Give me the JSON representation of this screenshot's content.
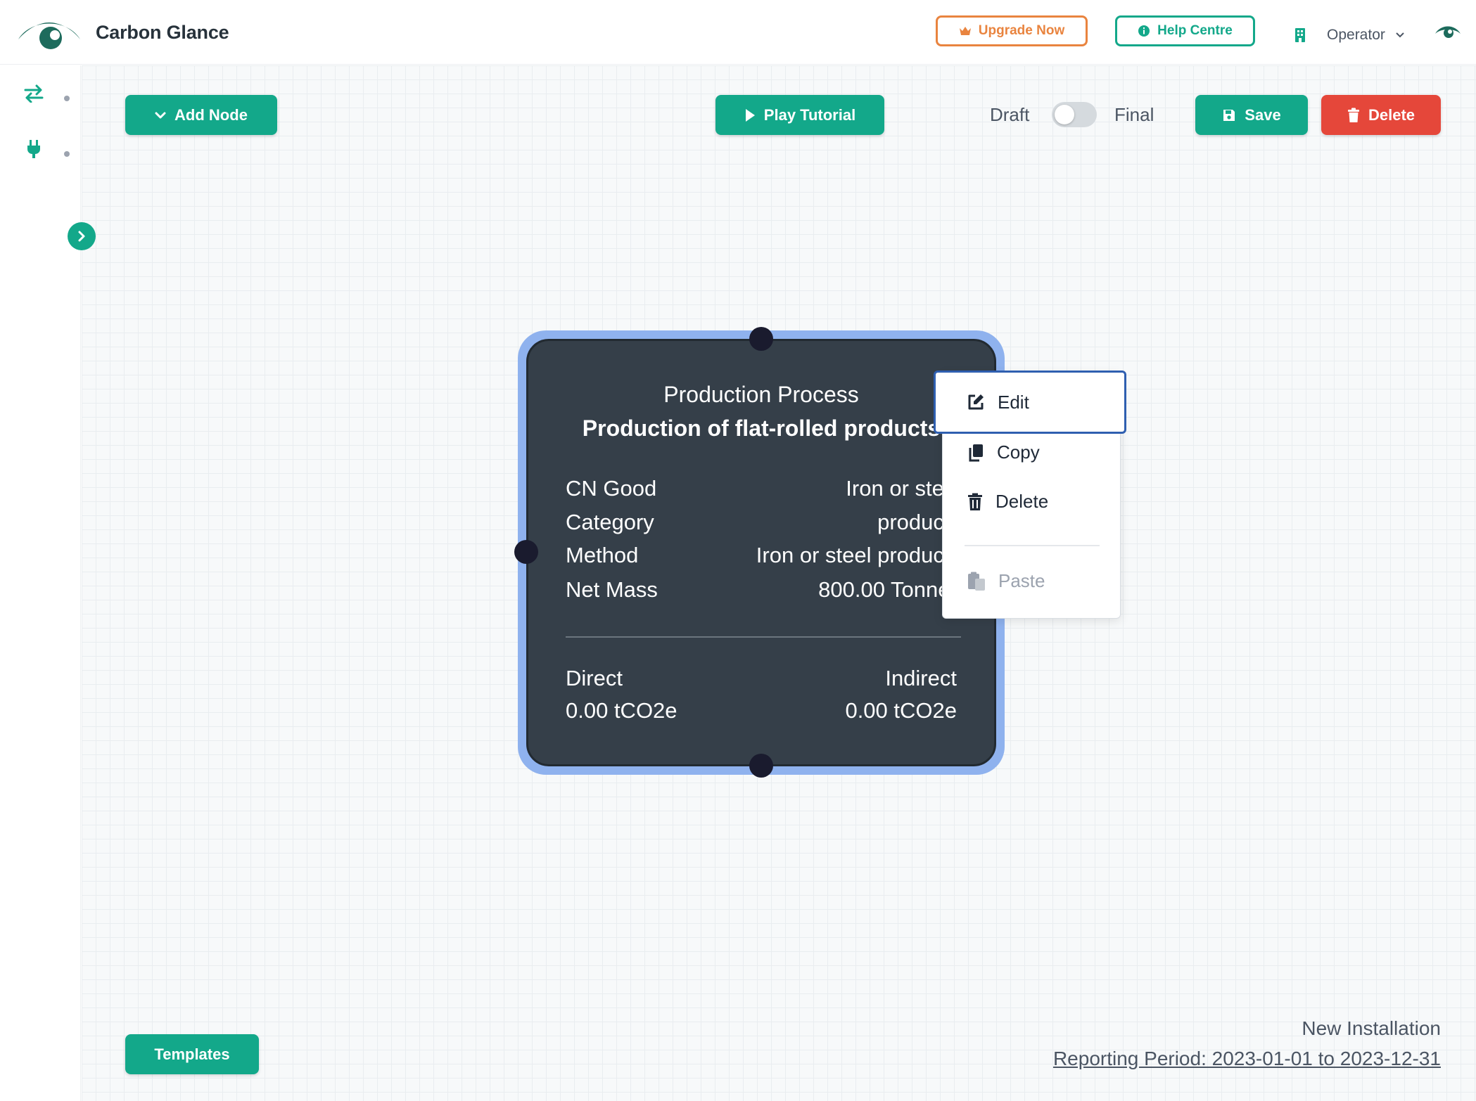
{
  "app": {
    "name": "Carbon Glance"
  },
  "header": {
    "upgrade_label": "Upgrade Now",
    "help_label": "Help Centre",
    "role_label": "Operator"
  },
  "toolbar": {
    "add_node_label": "Add Node",
    "play_tutorial_label": "Play Tutorial",
    "draft_label": "Draft",
    "final_label": "Final",
    "status_toggle_on": false,
    "save_label": "Save",
    "delete_label": "Delete"
  },
  "node": {
    "type": "Production Process",
    "title": "Production of flat-rolled products",
    "rows": [
      {
        "key": "CN Good",
        "value": "Iron or steel"
      },
      {
        "key": "Category",
        "value": "products"
      },
      {
        "key": "Method",
        "value": "Iron or steel products"
      },
      {
        "key": "Net Mass",
        "value": "800.00 Tonnes"
      }
    ],
    "direct_label": "Direct",
    "direct_value": "0.00 tCO2e",
    "indirect_label": "Indirect",
    "indirect_value": "0.00 tCO2e"
  },
  "context_menu": {
    "edit": "Edit",
    "copy": "Copy",
    "delete": "Delete",
    "paste": "Paste"
  },
  "footer": {
    "templates_label": "Templates",
    "installation_name": "New Installation",
    "reporting_period": "Reporting Period: 2023-01-01 to 2023-12-31"
  },
  "colors": {
    "brand_green": "#13a88a",
    "upgrade_orange": "#e9843f",
    "delete_red": "#e5473a",
    "node_bg": "#353f49",
    "node_selected_ring": "#8fb2ee"
  },
  "icons": {
    "logo": "eye-logo",
    "upgrade": "crown-icon",
    "help": "info-circle-icon",
    "role": "building-icon",
    "role_caret": "chevron-down-icon",
    "visibility": "eye-icon",
    "rail_flows": "arrows-exchange-icon",
    "rail_energy": "plug-icon",
    "rail_expand": "chevron-right-icon",
    "add_node": "chevron-down-icon",
    "play": "play-icon",
    "save": "floppy-disk-icon",
    "delete": "trash-icon",
    "edit": "pencil-square-icon",
    "copy": "copy-icon",
    "paste": "paste-icon"
  }
}
